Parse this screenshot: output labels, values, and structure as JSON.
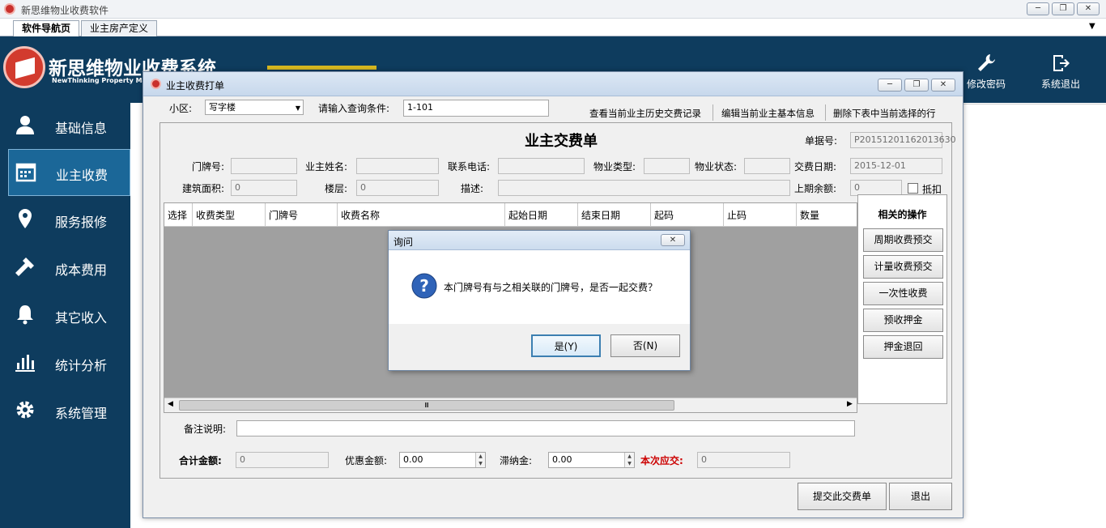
{
  "outer": {
    "title": "新思维物业收费软件",
    "min": "─",
    "restore": "❐",
    "close": "✕"
  },
  "tabs": [
    {
      "label": "软件导航页"
    },
    {
      "label": "业主房产定义"
    }
  ],
  "tab_dropdown": "▼",
  "brand": {
    "name": "新思维物业收费系统",
    "sub": "NewThinking  Property  Ma"
  },
  "header_actions": [
    {
      "label": "修改密码",
      "icon": "wrench-icon"
    },
    {
      "label": "系统退出",
      "icon": "logout-icon"
    }
  ],
  "sidebar": {
    "items": [
      {
        "label": "基础信息",
        "icon": "user-icon"
      },
      {
        "label": "业主收费",
        "icon": "calendar-icon"
      },
      {
        "label": "服务报修",
        "icon": "location-pin-icon"
      },
      {
        "label": "成本费用",
        "icon": "hammer-icon"
      },
      {
        "label": "其它收入",
        "icon": "bell-icon"
      },
      {
        "label": "统计分析",
        "icon": "bar-chart-icon"
      },
      {
        "label": "系统管理",
        "icon": "gear-icon"
      }
    ],
    "active_index": 1
  },
  "window": {
    "title": "业主收费打单",
    "min": "─",
    "restore": "❐",
    "close": "✕",
    "district_label": "小区:",
    "district_value": "写字楼",
    "query_label": "请输入查询条件:",
    "query_value": "1-101",
    "links": [
      "查看当前业主历史交费记录",
      "编辑当前业主基本信息",
      "删除下表中当前选择的行"
    ],
    "form": {
      "heading": "业主交费单",
      "bill_no_label": "单据号:",
      "bill_no_value": "P20151201162013630",
      "door_label": "门牌号:",
      "door_value": "",
      "owner_label": "业主姓名:",
      "owner_value": "",
      "phone_label": "联系电话:",
      "phone_value": "",
      "prop_type_label": "物业类型:",
      "prop_type_value": "",
      "prop_status_label": "物业状态:",
      "prop_status_value": "",
      "pay_date_label": "交费日期:",
      "pay_date_value": "2015-12-01",
      "area_label": "建筑面积:",
      "area_value": "0",
      "floor_label": "楼层:",
      "floor_value": "0",
      "desc_label": "描述:",
      "desc_value": "",
      "prev_balance_label": "上期余额:",
      "prev_balance_value": "0",
      "deduct_label": "抵扣"
    },
    "table": {
      "columns": [
        "选择",
        "收费类型",
        "门牌号",
        "收费名称",
        "起始日期",
        "结束日期",
        "起码",
        "止码",
        "数量"
      ],
      "scroll_mark": "Ⅲ"
    },
    "ops": {
      "title": "相关的操作",
      "buttons": [
        "周期收费预交",
        "计量收费预交",
        "一次性收费",
        "预收押金",
        "押金退回"
      ]
    },
    "remark_label": "备注说明:",
    "remark_value": "",
    "totals": {
      "total_label": "合计金额:",
      "total_value": "0",
      "discount_label": "优惠金额:",
      "discount_value": "0.00",
      "late_fee_label": "滞纳金:",
      "late_fee_value": "0.00",
      "due_label": "本次应交:",
      "due_value": "0"
    },
    "submit_label": "提交此交费单",
    "exit_label": "退出"
  },
  "msgbox": {
    "title": "询问",
    "close": "✕",
    "text": "本门牌号有与之相关联的门牌号，是否一起交费？",
    "yes": "是(Y)",
    "no": "否(N)"
  },
  "colors": {
    "sidebar": "#0e3c5e",
    "active": "#1b6798",
    "due_label": "#cc0000",
    "logo": "#d23b2e"
  }
}
